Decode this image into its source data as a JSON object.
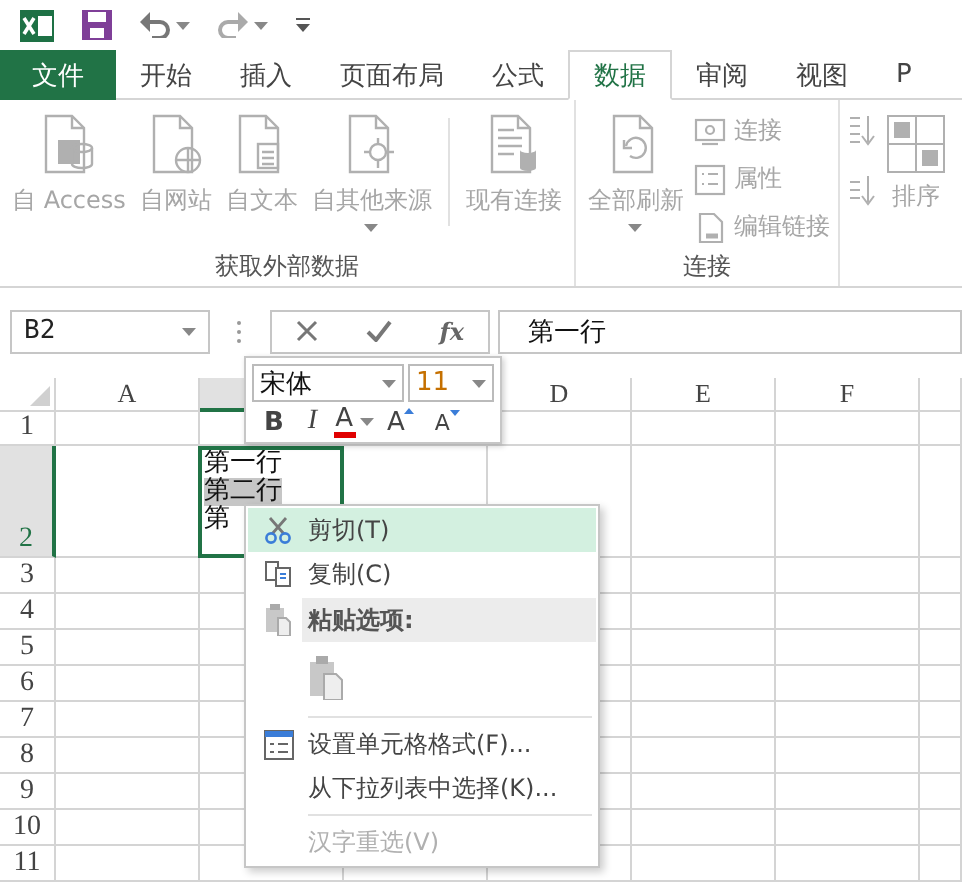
{
  "tabs": [
    {
      "label": "文件",
      "kind": "file",
      "selected": false
    },
    {
      "label": "开始",
      "kind": "tab",
      "selected": false
    },
    {
      "label": "插入",
      "kind": "tab",
      "selected": false
    },
    {
      "label": "页面布局",
      "kind": "tab",
      "selected": false
    },
    {
      "label": "公式",
      "kind": "tab",
      "selected": false
    },
    {
      "label": "数据",
      "kind": "tab",
      "selected": true
    },
    {
      "label": "审阅",
      "kind": "tab",
      "selected": false
    },
    {
      "label": "视图",
      "kind": "tab",
      "selected": false
    },
    {
      "label": "P",
      "kind": "tab",
      "selected": false
    }
  ],
  "ribbon": {
    "groups": [
      {
        "label": "获取外部数据",
        "items": [
          {
            "kind": "large",
            "label": "自 Access",
            "disabled": true,
            "has_menu": false
          },
          {
            "kind": "large",
            "label": "自网站",
            "disabled": true,
            "has_menu": false
          },
          {
            "kind": "large",
            "label": "自文本",
            "disabled": true,
            "has_menu": false
          },
          {
            "kind": "large",
            "label": "自其他来源",
            "disabled": true,
            "has_menu": true
          },
          {
            "kind": "separator"
          },
          {
            "kind": "large",
            "label": "现有连接",
            "disabled": true,
            "has_menu": false
          }
        ]
      },
      {
        "label": "连接",
        "items": [
          {
            "kind": "large",
            "label": "全部刷新",
            "disabled": true,
            "has_menu": true
          },
          {
            "kind": "small",
            "label": "连接",
            "disabled": true
          },
          {
            "kind": "small",
            "label": "属性",
            "disabled": true
          },
          {
            "kind": "small",
            "label": "编辑链接",
            "disabled": true
          }
        ]
      },
      {
        "items": [
          {
            "kind": "sort",
            "label": "排序",
            "disabled": true
          }
        ]
      }
    ]
  },
  "formula_bar": {
    "name_box": "B2",
    "insert_function": "fx",
    "value": "第一行"
  },
  "mini_toolbar": {
    "font": "宋体",
    "size": "11",
    "bold": "B",
    "italic": "I",
    "font_color": "A",
    "grow": "A",
    "shrink": "A"
  },
  "sheet": {
    "columns": [
      {
        "label": "A",
        "selected": false
      },
      {
        "selected": true
      },
      {},
      {
        "label": "D",
        "selected": false
      },
      {
        "label": "E",
        "selected": false
      },
      {
        "label": "F",
        "selected": false
      },
      {
        "selected": false
      }
    ],
    "rows": [
      {
        "label": "1",
        "selected": false
      },
      {
        "label": "2",
        "selected": true
      },
      {
        "label": "3",
        "selected": false
      },
      {
        "label": "4",
        "selected": false
      },
      {
        "label": "5",
        "selected": false
      },
      {
        "label": "6",
        "selected": false
      },
      {
        "label": "7",
        "selected": false
      },
      {
        "label": "8",
        "selected": false
      },
      {
        "label": "9",
        "selected": false
      },
      {
        "label": "10",
        "selected": false
      },
      {
        "label": "11",
        "selected": false
      }
    ],
    "active_cell_lines": [
      {
        "text": "第一行",
        "selected": false
      },
      {
        "text": "第二行",
        "selected": true
      },
      {
        "text": "第",
        "selected": false
      }
    ]
  },
  "context_menu": {
    "items": [
      {
        "kind": "command",
        "label": "剪切(T)",
        "selected": true,
        "disabled": false
      },
      {
        "kind": "command",
        "label": "复制(C)",
        "selected": false,
        "disabled": false
      },
      {
        "kind": "header",
        "label": "粘贴选项:"
      },
      {
        "kind": "paste-option"
      },
      {
        "kind": "separator"
      },
      {
        "kind": "command",
        "label": "设置单元格格式(F)...",
        "selected": false,
        "disabled": false
      },
      {
        "kind": "command",
        "label": "从下拉列表中选择(K)...",
        "selected": false,
        "disabled": false
      },
      {
        "kind": "separator"
      },
      {
        "kind": "command",
        "label": "汉字重选(V)",
        "selected": false,
        "disabled": true
      }
    ]
  }
}
